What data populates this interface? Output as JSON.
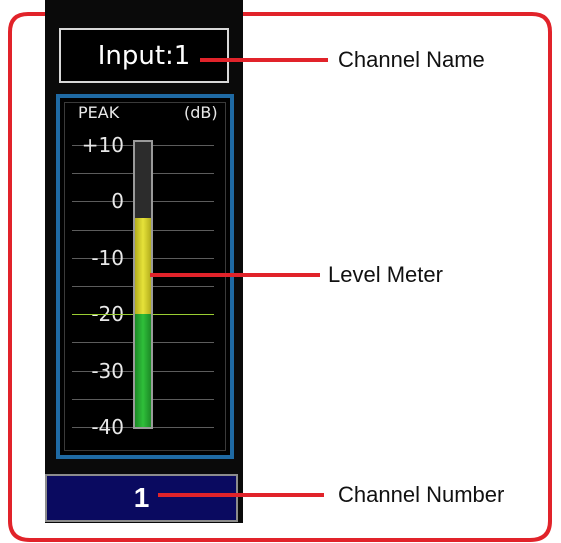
{
  "channel": {
    "name": "Input:1",
    "number": "1"
  },
  "meter": {
    "peak_label": "PEAK",
    "unit_label": "(dB)",
    "scale_db": [
      10,
      0,
      -10,
      -20,
      -30,
      -40
    ],
    "tick_labels": [
      "+10",
      "0",
      "-10",
      "-20",
      "-30",
      "-40"
    ],
    "level_db": -3,
    "reference_db": -20,
    "colors": {
      "frame": "#1f6aa4",
      "green": "#2fbf3a",
      "yellow": "#e6e23a",
      "reference_line": "#9acd32"
    }
  },
  "callouts": {
    "channel_name": "Channel Name",
    "level_meter": "Level Meter",
    "channel_number": "Channel Number"
  },
  "colors": {
    "highlight_outline": "#e1232a",
    "number_box": "#0a0a60"
  }
}
